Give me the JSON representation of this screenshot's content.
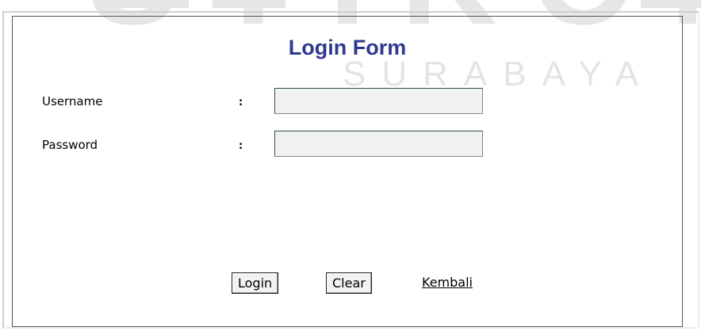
{
  "watermark": {
    "main_text": "STIKOM",
    "sub_text": "SURABAYA"
  },
  "form": {
    "title": "Login Form",
    "fields": [
      {
        "label": "Username",
        "separator": ":",
        "value": "",
        "type": "text"
      },
      {
        "label": "Password",
        "separator": ":",
        "value": "",
        "type": "password"
      }
    ],
    "buttons": {
      "login_label": "Login",
      "clear_label": "Clear"
    },
    "back_link": "Kembali"
  },
  "colors": {
    "title": "#2e3a8e",
    "input_background": "#f1f1f1",
    "watermark": "#e6e6e6"
  }
}
